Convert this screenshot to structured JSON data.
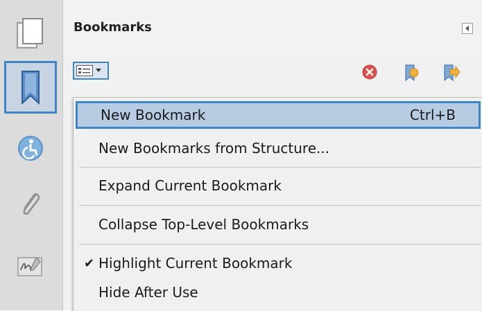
{
  "panel": {
    "title": "Bookmarks"
  },
  "rail": {
    "items": [
      {
        "icon": "pages-icon"
      },
      {
        "icon": "bookmark-icon",
        "active": true
      },
      {
        "icon": "accessibility-icon"
      },
      {
        "icon": "paperclip-icon"
      },
      {
        "icon": "signature-icon"
      }
    ]
  },
  "toolbar": {
    "options_icon": "options-menu-icon",
    "delete_icon": "delete-bookmark-icon",
    "expand_icon": "expand-bookmark-icon",
    "new_icon": "new-bookmark-icon"
  },
  "menu": {
    "items": [
      {
        "label": "New Bookmark",
        "shortcut": "Ctrl+B",
        "highlighted": true
      },
      {
        "label": "New Bookmarks from Structure..."
      },
      {
        "label": "Expand Current Bookmark"
      },
      {
        "label": "Collapse Top-Level Bookmarks"
      },
      {
        "label": "Highlight Current Bookmark",
        "checked": true,
        "check_mark": "✔"
      },
      {
        "label": "Hide After Use"
      }
    ]
  },
  "colors": {
    "accent": "#3f84c6",
    "highlight_bg": "#b7cbe2",
    "rail_bg": "#dcdcdc",
    "panel_bg": "#f1f1f1"
  }
}
